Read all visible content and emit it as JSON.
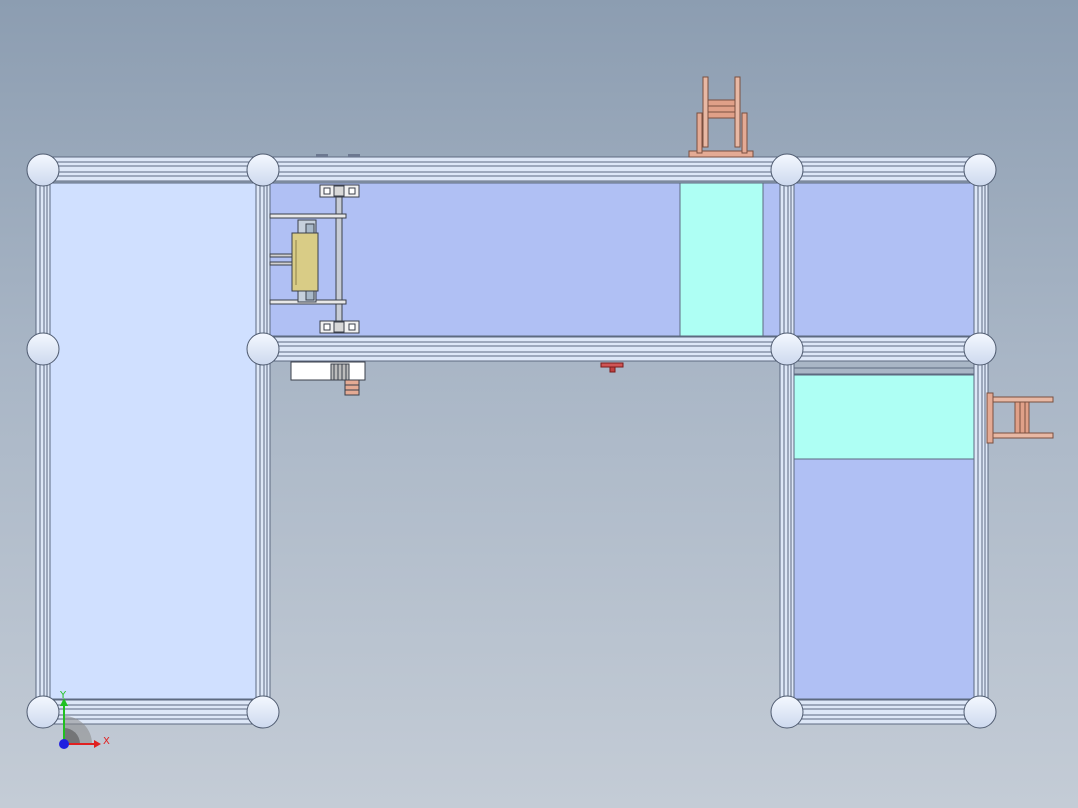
{
  "viewport": {
    "background_top": "#8c9db1",
    "background_bottom": "#c4ccd6"
  },
  "colors": {
    "panel_light": "#d0e0ff",
    "panel_mid": "#b0c0f4",
    "panel_cyan": "#aefff4",
    "frame": "#dde7f7",
    "frame_line": "#5d6a80",
    "node": "#e6eefb",
    "copper": "#e4aa94",
    "module_tan": "#d9cc86"
  },
  "triad": {
    "x_label": "X",
    "y_label": "Y",
    "x_color": "#e02020",
    "y_color": "#20c020",
    "z_color": "#2020e0"
  }
}
